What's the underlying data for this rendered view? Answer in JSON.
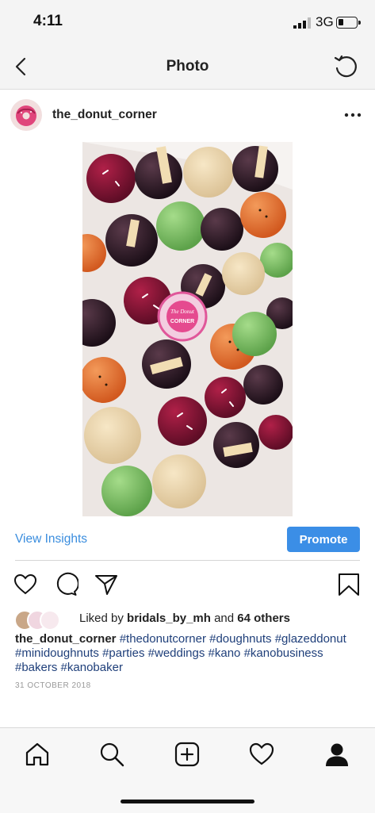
{
  "status_bar": {
    "time": "4:11",
    "network": "3G",
    "battery_level": 0.3
  },
  "nav": {
    "title": "Photo",
    "back_icon": "chevron-left-icon",
    "refresh_icon": "refresh-icon"
  },
  "post": {
    "username": "the_donut_corner",
    "photo_watermark_text": "The Donut CORNER",
    "insights_label": "View Insights",
    "promote_label": "Promote",
    "liked_prefix": "Liked by",
    "liked_user": "bridals_by_mh",
    "liked_and": "and",
    "liked_others": "64 others",
    "caption_user": "the_donut_corner",
    "caption_hashtags": [
      "#thedonutcorner",
      "#doughnuts",
      "#glazeddonut",
      "#minidoughnuts",
      "#parties",
      "#weddings",
      "#kano",
      "#kanobusiness",
      "#bakers",
      "#kanobaker"
    ],
    "date": "31 OCTOBER 2018"
  },
  "colors": {
    "accent": "#3b8ee6",
    "link": "#3a8dde",
    "hashtag": "#1f3f7a"
  },
  "icons": [
    "heart-icon",
    "comment-icon",
    "share-icon",
    "bookmark-icon",
    "home-icon",
    "search-icon",
    "add-post-icon",
    "activity-heart-icon",
    "profile-icon"
  ]
}
